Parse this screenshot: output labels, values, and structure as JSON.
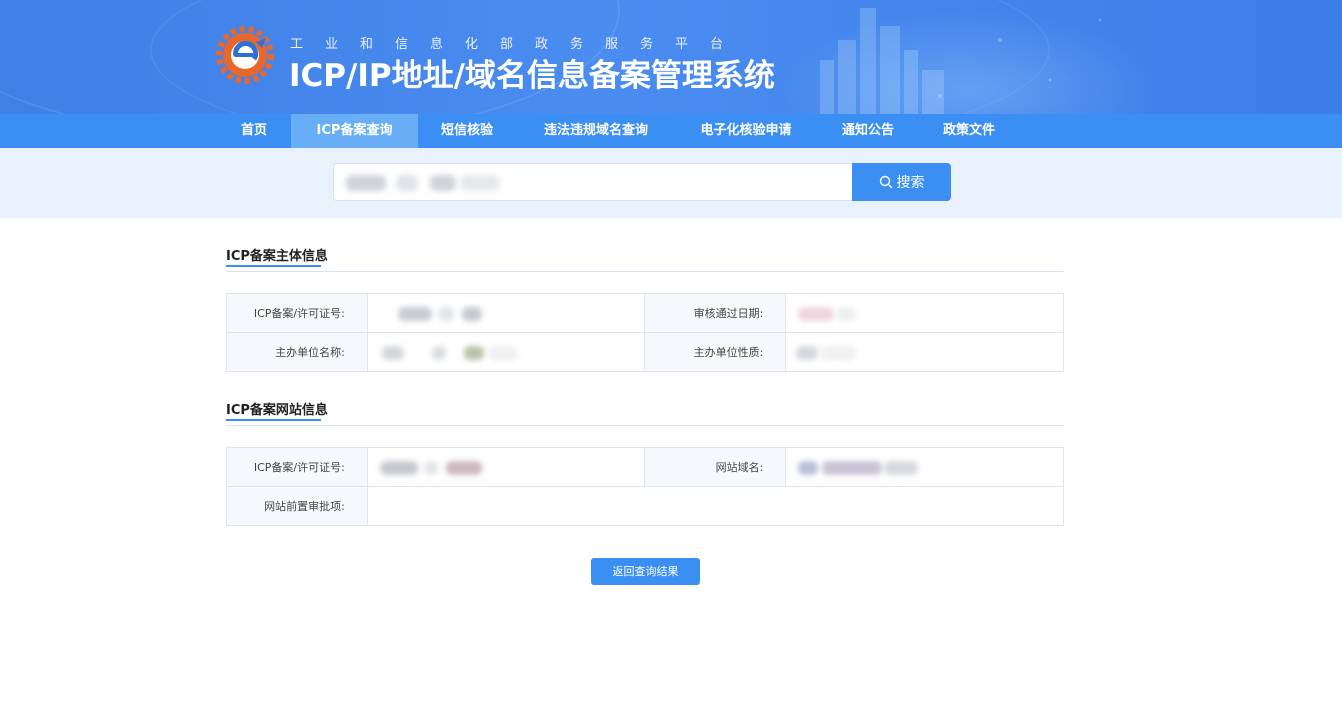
{
  "header": {
    "platform_name": "工业和信息化部政务服务平台",
    "system_title": "ICP/IP地址/域名信息备案管理系统"
  },
  "nav": {
    "items": [
      {
        "label": "首页"
      },
      {
        "label": "ICP备案查询",
        "active": true
      },
      {
        "label": "短信核验"
      },
      {
        "label": "违法违规域名查询"
      },
      {
        "label": "电子化核验申请"
      },
      {
        "label": "通知公告"
      },
      {
        "label": "政策文件"
      }
    ]
  },
  "search": {
    "placeholder": "",
    "button_label": "搜索"
  },
  "subject_section": {
    "title": "ICP备案主体信息",
    "fields": {
      "license_label": "ICP备案/许可证号:",
      "approval_date_label": "审核通过日期:",
      "org_name_label": "主办单位名称:",
      "org_type_label": "主办单位性质:"
    }
  },
  "website_section": {
    "title": "ICP备案网站信息",
    "fields": {
      "license_label": "ICP备案/许可证号:",
      "domain_label": "网站域名:",
      "preapproval_label": "网站前置审批项:"
    }
  },
  "actions": {
    "back_label": "返回查询结果"
  },
  "colors": {
    "primary": "#3b8ff2",
    "nav_active": "#68aef6",
    "search_band": "#e8f1fc"
  }
}
